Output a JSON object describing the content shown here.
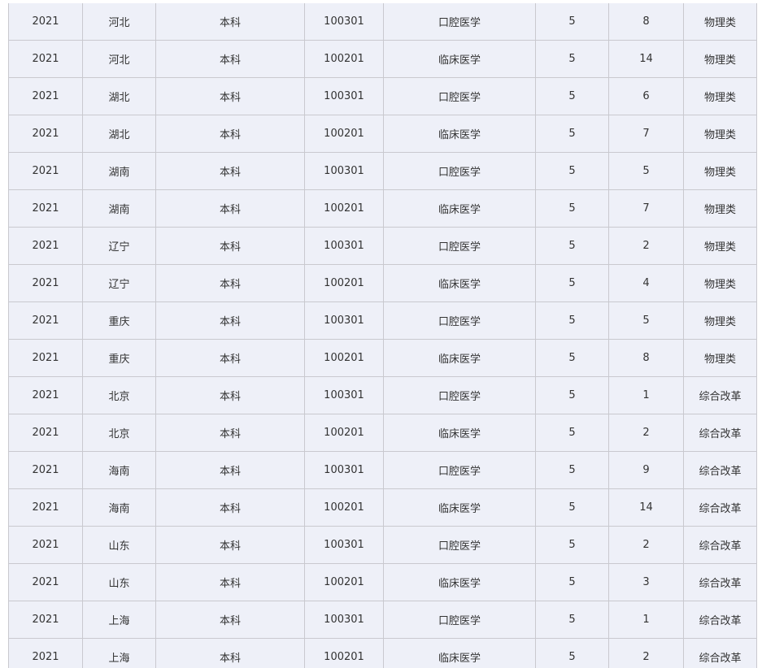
{
  "table": {
    "rows": [
      [
        "2021",
        "河北",
        "本科",
        "100301",
        "口腔医学",
        "5",
        "8",
        "物理类"
      ],
      [
        "2021",
        "河北",
        "本科",
        "100201",
        "临床医学",
        "5",
        "14",
        "物理类"
      ],
      [
        "2021",
        "湖北",
        "本科",
        "100301",
        "口腔医学",
        "5",
        "6",
        "物理类"
      ],
      [
        "2021",
        "湖北",
        "本科",
        "100201",
        "临床医学",
        "5",
        "7",
        "物理类"
      ],
      [
        "2021",
        "湖南",
        "本科",
        "100301",
        "口腔医学",
        "5",
        "5",
        "物理类"
      ],
      [
        "2021",
        "湖南",
        "本科",
        "100201",
        "临床医学",
        "5",
        "7",
        "物理类"
      ],
      [
        "2021",
        "辽宁",
        "本科",
        "100301",
        "口腔医学",
        "5",
        "2",
        "物理类"
      ],
      [
        "2021",
        "辽宁",
        "本科",
        "100201",
        "临床医学",
        "5",
        "4",
        "物理类"
      ],
      [
        "2021",
        "重庆",
        "本科",
        "100301",
        "口腔医学",
        "5",
        "5",
        "物理类"
      ],
      [
        "2021",
        "重庆",
        "本科",
        "100201",
        "临床医学",
        "5",
        "8",
        "物理类"
      ],
      [
        "2021",
        "北京",
        "本科",
        "100301",
        "口腔医学",
        "5",
        "1",
        "综合改革"
      ],
      [
        "2021",
        "北京",
        "本科",
        "100201",
        "临床医学",
        "5",
        "2",
        "综合改革"
      ],
      [
        "2021",
        "海南",
        "本科",
        "100301",
        "口腔医学",
        "5",
        "9",
        "综合改革"
      ],
      [
        "2021",
        "海南",
        "本科",
        "100201",
        "临床医学",
        "5",
        "14",
        "综合改革"
      ],
      [
        "2021",
        "山东",
        "本科",
        "100301",
        "口腔医学",
        "5",
        "2",
        "综合改革"
      ],
      [
        "2021",
        "山东",
        "本科",
        "100201",
        "临床医学",
        "5",
        "3",
        "综合改革"
      ],
      [
        "2021",
        "上海",
        "本科",
        "100301",
        "口腔医学",
        "5",
        "1",
        "综合改革"
      ],
      [
        "2021",
        "上海",
        "本科",
        "100201",
        "临床医学",
        "5",
        "2",
        "综合改革"
      ]
    ]
  }
}
